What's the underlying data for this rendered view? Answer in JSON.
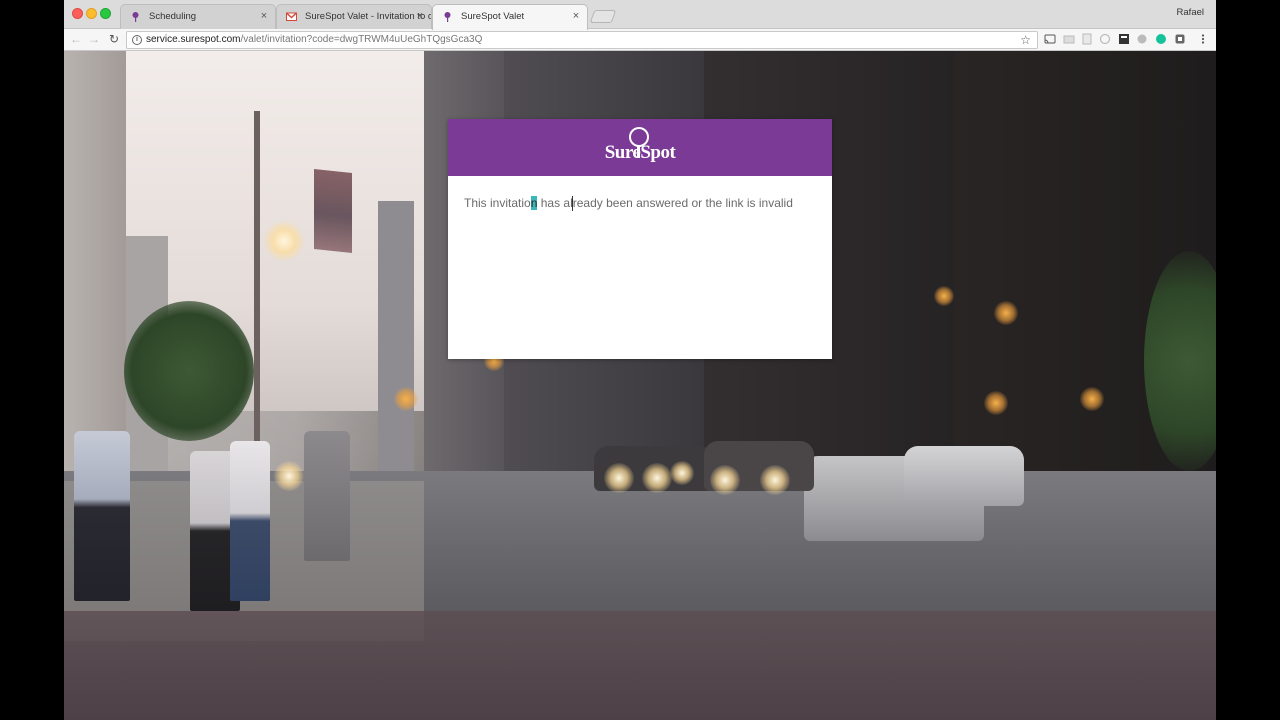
{
  "browser": {
    "tabs": [
      {
        "title": "Scheduling",
        "active": false,
        "favicon": "pin-icon"
      },
      {
        "title": "SureSpot Valet - Invitation to c",
        "active": false,
        "favicon": "gmail-icon"
      },
      {
        "title": "SureSpot Valet",
        "active": true,
        "favicon": "pin-icon"
      }
    ],
    "close_glyph": "×",
    "profile_name": "Rafael",
    "url_host": "service.surespot.com",
    "url_path": "/valet/invitation?code=dwgTRWM4uUeGhTQgsGca3Q",
    "info_glyph": "i",
    "star_glyph": "☆",
    "back_glyph": "←",
    "forward_glyph": "→",
    "reload_glyph": "↻"
  },
  "page": {
    "logo_text": "SureSpot",
    "message_before": "This invitatio",
    "message_highlight": "n",
    "message_after": " has already been answered or the link is invalid"
  },
  "colors": {
    "header_purple": "#7b3a96",
    "selection": "#3cb7b7"
  }
}
